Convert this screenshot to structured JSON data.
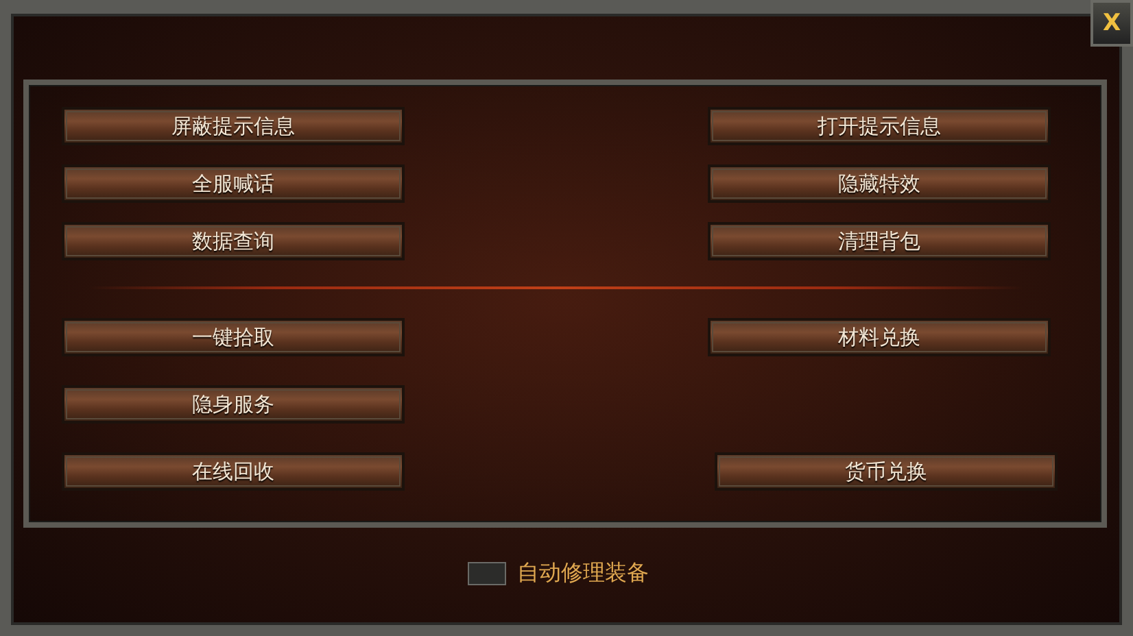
{
  "close_button": {
    "label": "X"
  },
  "groups": [
    {
      "rows": [
        {
          "left": "屏蔽提示信息",
          "right": "打开提示信息"
        },
        {
          "left": "全服喊话",
          "right": "隐藏特效"
        },
        {
          "left": "数据查询",
          "right": "清理背包"
        }
      ]
    },
    {
      "rows": [
        {
          "left": "一键拾取",
          "right": "材料兑换"
        },
        {
          "left": "隐身服务"
        },
        {
          "left": "在线回收",
          "right": "货币兑换"
        }
      ]
    }
  ],
  "auto_repair": {
    "label": "自动修理装备",
    "checked": false
  }
}
